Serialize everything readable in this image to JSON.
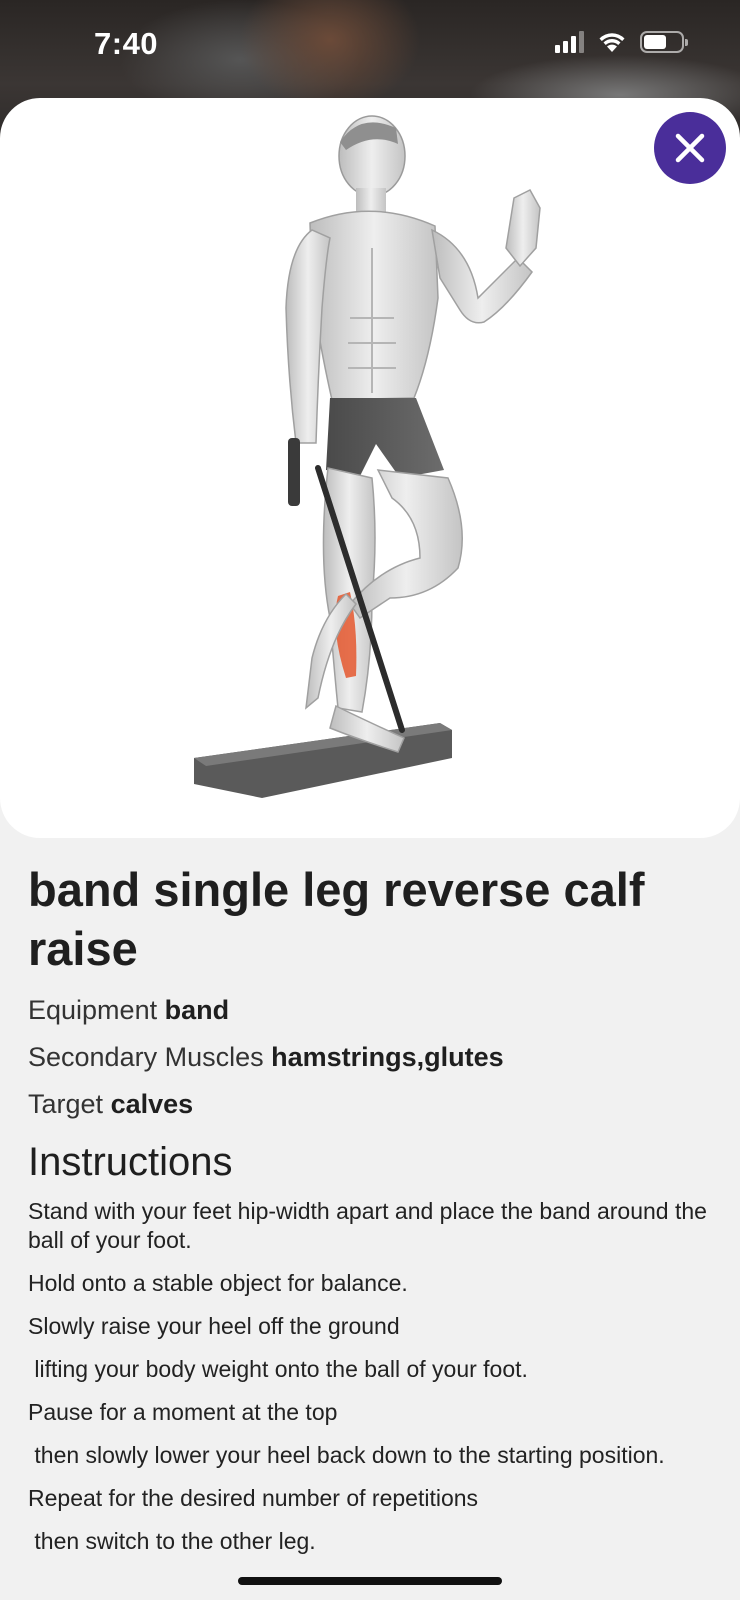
{
  "status_bar": {
    "time": "7:40",
    "icons": [
      "cellular-signal-icon",
      "wifi-icon",
      "battery-icon"
    ]
  },
  "image": {
    "description_icon": "exercise-illustration",
    "close_icon": "close-icon",
    "highlight_color": "#e4572e"
  },
  "exercise": {
    "title": "band single leg reverse calf raise",
    "equipment": {
      "label": "Equipment",
      "value": "band"
    },
    "secondary_muscles": {
      "label": "Secondary Muscles",
      "value": "hamstrings,glutes"
    },
    "target": {
      "label": "Target",
      "value": "calves"
    }
  },
  "instructions": {
    "heading": "Instructions",
    "steps": [
      "Stand with your feet hip-width apart and place the band around the ball of your foot.",
      "Hold onto a stable object for balance.",
      "Slowly raise your heel off the ground",
      " lifting your body weight onto the ball of your foot.",
      "Pause for a moment at the top",
      " then slowly lower your heel back down to the starting position.",
      "Repeat for the desired number of repetitions",
      " then switch to the other leg."
    ]
  },
  "colors": {
    "accent": "#4a2e9a",
    "background": "#f1f1f1",
    "card": "#ffffff"
  }
}
